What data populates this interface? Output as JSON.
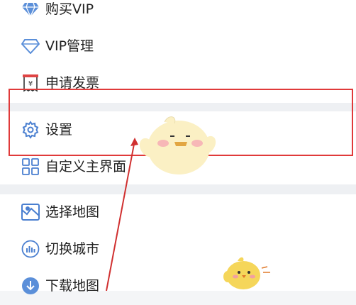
{
  "menu": {
    "items": [
      {
        "label": "购买VIP",
        "icon": "diamond-icon"
      },
      {
        "label": "VIP管理",
        "icon": "diamond-outline-icon"
      },
      {
        "label": "申请发票",
        "icon": "receipt-icon"
      },
      {
        "label": "设置",
        "icon": "gear-icon"
      },
      {
        "label": "自定义主界面",
        "icon": "grid-icon"
      },
      {
        "label": "选择地图",
        "icon": "map-icon"
      },
      {
        "label": "切换城市",
        "icon": "city-chart-icon"
      },
      {
        "label": "下载地图",
        "icon": "download-icon"
      }
    ]
  },
  "annotation": {
    "color": "#e03a3a"
  }
}
